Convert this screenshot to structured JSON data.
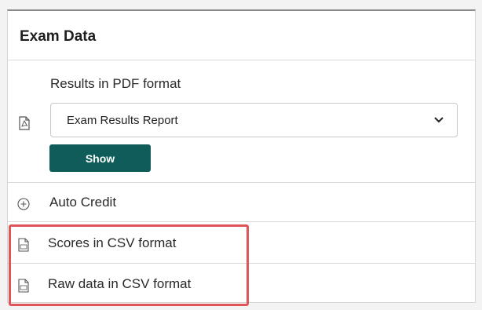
{
  "panel": {
    "title": "Exam Data"
  },
  "pdf_section": {
    "label": "Results in PDF format",
    "icon": "pdf-file-icon",
    "select": {
      "value": "Exam Results Report"
    },
    "show_button": "Show"
  },
  "auto_credit": {
    "label": "Auto Credit",
    "icon": "plus-circle-icon"
  },
  "scores_csv": {
    "label": "Scores in CSV format",
    "icon": "csv-file-icon"
  },
  "raw_csv": {
    "label": "Raw data in CSV format",
    "icon": "csv-file-icon"
  },
  "colors": {
    "button": "#0f5c5a",
    "highlight": "#e05558"
  }
}
